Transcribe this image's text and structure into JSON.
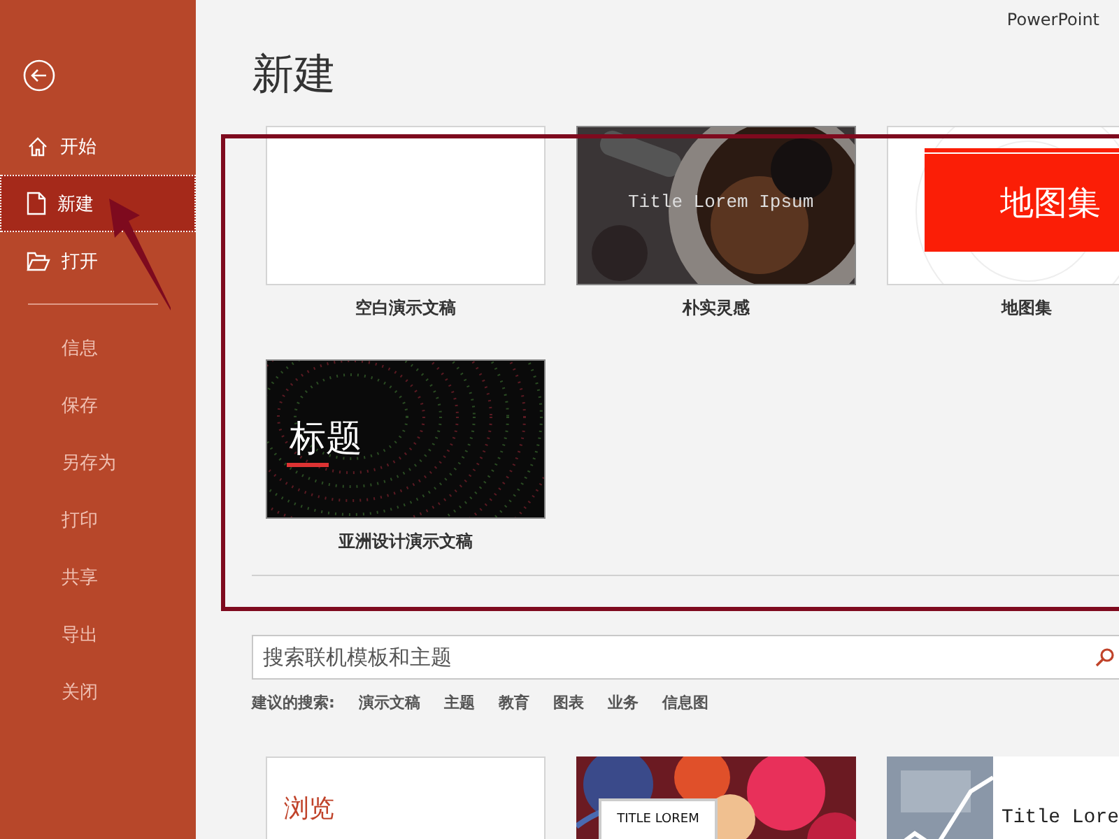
{
  "app_name": "PowerPoint",
  "sidebar": {
    "items": [
      {
        "label": "开始",
        "kind": "home",
        "selected": false
      },
      {
        "label": "新建",
        "kind": "file",
        "selected": true
      },
      {
        "label": "打开",
        "kind": "folder",
        "selected": false
      },
      {
        "label": "信息",
        "kind": "plain",
        "selected": false
      },
      {
        "label": "保存",
        "kind": "plain",
        "selected": false
      },
      {
        "label": "另存为",
        "kind": "plain",
        "selected": false
      },
      {
        "label": "打印",
        "kind": "plain",
        "selected": false
      },
      {
        "label": "共享",
        "kind": "plain",
        "selected": false
      },
      {
        "label": "导出",
        "kind": "plain",
        "selected": false
      },
      {
        "label": "关闭",
        "kind": "plain",
        "selected": false
      }
    ]
  },
  "heading": "新建",
  "templates": [
    {
      "name": "空白演示文稿",
      "kind": "blank"
    },
    {
      "name": "朴实灵感",
      "title": "Title Lorem Ipsum"
    },
    {
      "name": "地图集",
      "kind": "banner",
      "title": "地图集"
    },
    {
      "name": "亚洲设计演示文稿",
      "kind": "dots",
      "title": "标题"
    }
  ],
  "search": {
    "placeholder": "搜索联机模板和主题"
  },
  "suggestions": {
    "label": "建议的搜索:",
    "items": [
      "演示文稿",
      "主题",
      "教育",
      "图表",
      "业务",
      "信息图"
    ]
  },
  "more_templates": [
    {
      "kind": "browse",
      "title": "浏览"
    },
    {
      "kind": "floral",
      "title": "TITLE LOREM"
    },
    {
      "kind": "chart",
      "title": "Title Lore"
    }
  ]
}
